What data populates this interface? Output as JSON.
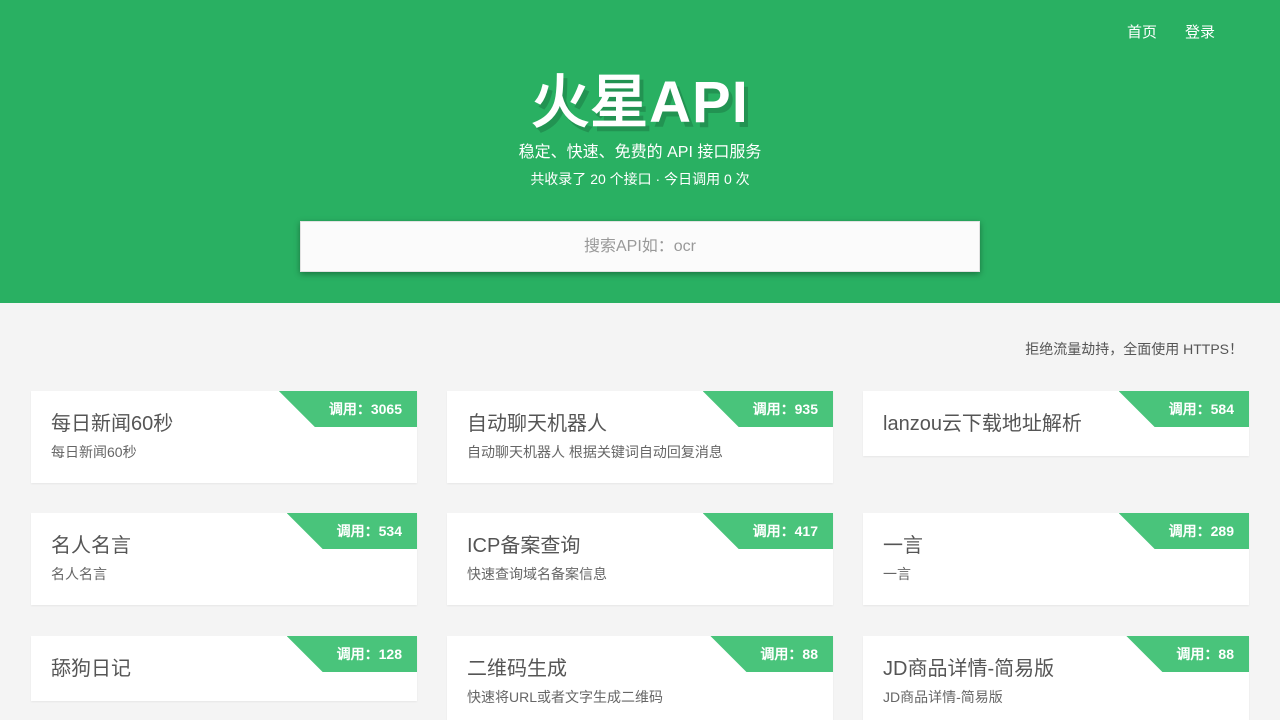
{
  "nav": {
    "home": "首页",
    "login": "登录"
  },
  "hero": {
    "title": "火星API",
    "tagline": "稳定、快速、免费的 API 接口服务",
    "stats": "共收录了 20 个接口 · 今日调用 0 次"
  },
  "search": {
    "placeholder": "搜索API如：ocr"
  },
  "notice": "拒绝流量劫持，全面使用 HTTPS！",
  "cards": [
    {
      "title": "每日新闻60秒",
      "desc": "每日新闻60秒",
      "calls": "调用：3065"
    },
    {
      "title": "自动聊天机器人",
      "desc": "自动聊天机器人 根据关键词自动回复消息",
      "calls": "调用：935"
    },
    {
      "title": "lanzou云下载地址解析",
      "desc": "",
      "calls": "调用：584"
    },
    {
      "title": "名人名言",
      "desc": "名人名言",
      "calls": "调用：534"
    },
    {
      "title": "ICP备案查询",
      "desc": "快速查询域名备案信息",
      "calls": "调用：417"
    },
    {
      "title": "一言",
      "desc": "一言",
      "calls": "调用：289"
    },
    {
      "title": "舔狗日记",
      "desc": "",
      "calls": "调用：128"
    },
    {
      "title": "二维码生成",
      "desc": "快速将URL或者文字生成二维码",
      "calls": "调用：88"
    },
    {
      "title": "JD商品详情-简易版",
      "desc": "JD商品详情-简易版",
      "calls": "调用：88"
    }
  ]
}
